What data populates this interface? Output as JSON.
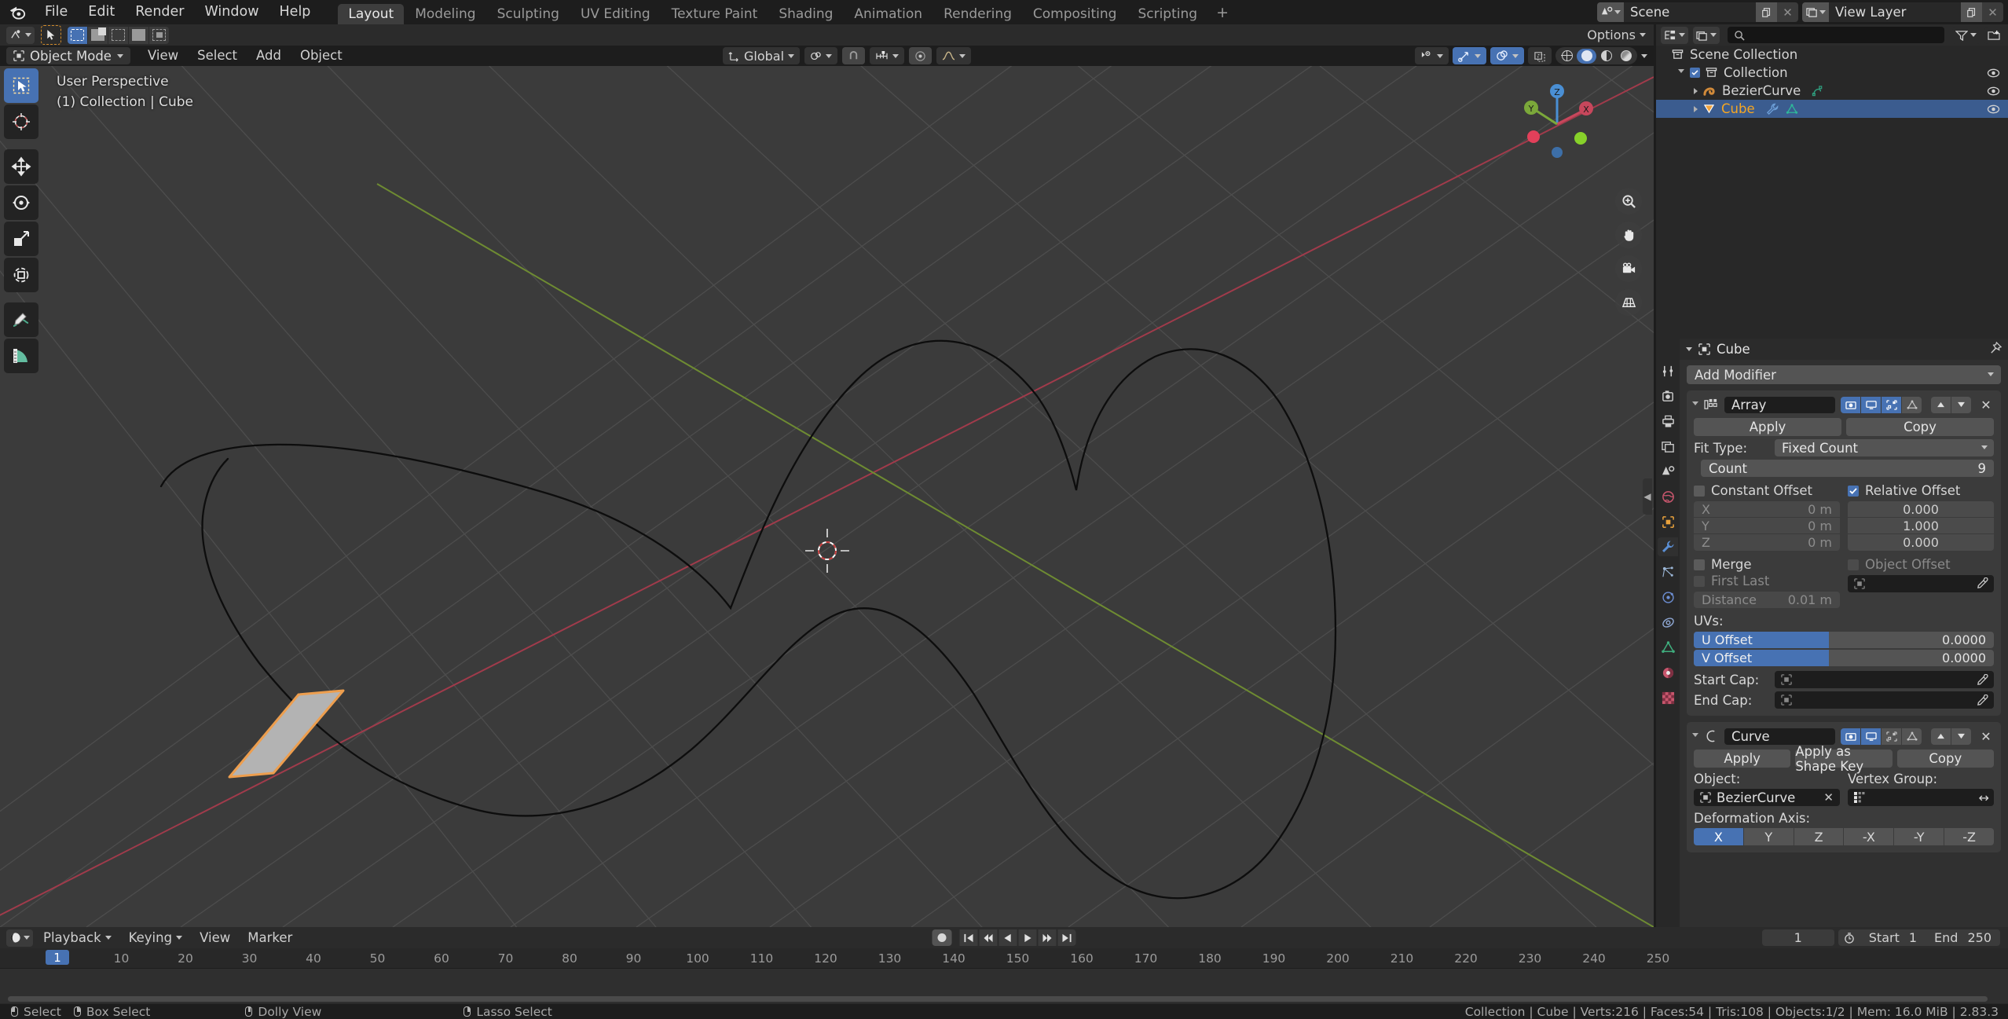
{
  "topbar": {
    "logo_icon": "blender-logo-icon",
    "menus": [
      "File",
      "Edit",
      "Render",
      "Window",
      "Help"
    ],
    "workspace_tabs": [
      {
        "label": "Layout",
        "active": true
      },
      {
        "label": "Modeling",
        "active": false
      },
      {
        "label": "Sculpting",
        "active": false
      },
      {
        "label": "UV Editing",
        "active": false
      },
      {
        "label": "Texture Paint",
        "active": false
      },
      {
        "label": "Shading",
        "active": false
      },
      {
        "label": "Animation",
        "active": false
      },
      {
        "label": "Rendering",
        "active": false
      },
      {
        "label": "Compositing",
        "active": false
      },
      {
        "label": "Scripting",
        "active": false
      }
    ],
    "add_workspace_label": "+",
    "scene_name": "Scene",
    "view_layer_name": "View Layer"
  },
  "tool_settings": {
    "active_tool_icon": "cursor-select-icon",
    "select_modes": [
      "set",
      "extend",
      "subtract",
      "invert",
      "intersect"
    ],
    "options_label": "Options"
  },
  "viewport_header": {
    "mode": "Object Mode",
    "menus": [
      "View",
      "Select",
      "Add",
      "Object"
    ],
    "transform_orientation": "Global",
    "pivot_icon": "pivot-icon",
    "snap_icon": "magnet-icon",
    "snap_to_icon": "snap-increment-icon",
    "proportional_icon": "proportional-editing-icon",
    "falloff_icon": "falloff-curve-icon",
    "visibility_icon": "object-type-visibility-icon",
    "gizmo_icon": "gizmo-icon",
    "overlays_icon": "overlays-icon",
    "xray_icon": "xray-icon",
    "shading_modes": [
      "wireframe",
      "solid",
      "material-preview",
      "rendered"
    ],
    "shading_active": "solid"
  },
  "viewport": {
    "perspective_label": "User Perspective",
    "scene_label": "(1) Collection | Cube",
    "tools": [
      "tweak-select-tool",
      "cursor-tool",
      "move-tool",
      "rotate-tool",
      "scale-tool",
      "transform-tool",
      "annotate-tool",
      "measure-tool"
    ],
    "gizmo_axes": [
      "X",
      "Y",
      "Z"
    ],
    "nav_buttons": [
      "zoom-icon",
      "pan-hand-icon",
      "camera-view-icon",
      "toggle-ortho-icon"
    ],
    "cube_color": "#b3b3b3",
    "cube_outline": "#ed9e4e",
    "curve_color": "#0d0d0d",
    "x_axis_color": "#a03b4b",
    "y_axis_color": "#6e8b32"
  },
  "outliner": {
    "display_mode_icon": "outliner-display-mode-icon",
    "filter_icon": "filter-funnel-icon",
    "new_collection_icon": "new-collection-icon",
    "search_placeholder": "",
    "rows": [
      {
        "label": "Scene Collection",
        "icon": "collection-icon",
        "depth": 0,
        "selected": false,
        "has_eye": false,
        "has_check": false,
        "expand": "none"
      },
      {
        "label": "Collection",
        "icon": "collection-icon",
        "depth": 1,
        "selected": false,
        "has_eye": true,
        "has_check": true,
        "expand": "down"
      },
      {
        "label": "BezierCurve",
        "icon": "curve-data-icon",
        "depth": 2,
        "selected": false,
        "has_eye": true,
        "has_check": false,
        "expand": "right",
        "extra_icon": "curve-object-icon"
      },
      {
        "label": "Cube",
        "icon": "mesh-data-icon",
        "depth": 2,
        "selected": true,
        "has_eye": true,
        "has_check": false,
        "expand": "right",
        "extra_icon": "modifier-wrench-icon",
        "extra_icon2": "mesh-triangle-icon"
      }
    ]
  },
  "properties": {
    "breadcrumb_object": "Cube",
    "breadcrumb_icon": "object-data-icon",
    "pin_icon": "pin-icon",
    "tabs": [
      "tool-icon",
      "render-icon",
      "output-icon",
      "view-layer-icon",
      "scene-icon",
      "world-icon",
      "object-icon",
      "modifier-wrench-icon",
      "particles-icon",
      "physics-icon",
      "constraints-icon",
      "object-data-icon",
      "material-icon",
      "texture-icon"
    ],
    "active_tab": "modifier-wrench-icon",
    "add_modifier_label": "Add Modifier",
    "modifiers": [
      {
        "name": "Array",
        "icon": "array-modifier-icon",
        "toggles": [
          {
            "icon": "render-camera-icon",
            "on": true
          },
          {
            "icon": "display-monitor-icon",
            "on": true
          },
          {
            "icon": "edit-mode-icon",
            "on": true
          },
          {
            "icon": "on-cage-icon",
            "on": false
          }
        ],
        "buttons": [
          "Apply",
          "Copy"
        ],
        "fit_type_label": "Fit Type:",
        "fit_type_value": "Fixed Count",
        "count_label": "Count",
        "count_value": "9",
        "constant_offset_label": "Constant Offset",
        "constant_offset_on": false,
        "constant_offset_fields": [
          {
            "label": "X",
            "value": "0 m"
          },
          {
            "label": "Y",
            "value": "0 m"
          },
          {
            "label": "Z",
            "value": "0 m"
          }
        ],
        "relative_offset_label": "Relative Offset",
        "relative_offset_on": true,
        "relative_offset_fields": [
          "0.000",
          "1.000",
          "0.000"
        ],
        "merge_label": "Merge",
        "merge_on": false,
        "first_last_label": "First Last",
        "first_last_on": false,
        "distance_label": "Distance",
        "distance_value": "0.01 m",
        "object_offset_label": "Object Offset",
        "object_offset_on": false,
        "object_offset_value": "",
        "uvs_label": "UVs:",
        "u_offset_label": "U Offset",
        "u_offset_value": "0.0000",
        "v_offset_label": "V Offset",
        "v_offset_value": "0.0000",
        "start_cap_label": "Start Cap:",
        "start_cap_value": "",
        "end_cap_label": "End Cap:",
        "end_cap_value": ""
      },
      {
        "name": "Curve",
        "icon": "curve-modifier-icon",
        "toggles": [
          {
            "icon": "render-camera-icon",
            "on": true
          },
          {
            "icon": "display-monitor-icon",
            "on": true
          },
          {
            "icon": "edit-mode-icon",
            "on": false
          },
          {
            "icon": "on-cage-icon",
            "on": false
          }
        ],
        "buttons": [
          "Apply",
          "Apply as Shape Key",
          "Copy"
        ],
        "object_label": "Object:",
        "object_value": "BezierCurve",
        "vertex_group_label": "Vertex Group:",
        "vertex_group_value": "",
        "deformation_axis_label": "Deformation Axis:",
        "deformation_axes": [
          "X",
          "Y",
          "Z",
          "-X",
          "-Y",
          "-Z"
        ],
        "deformation_active": "X"
      }
    ]
  },
  "timeline": {
    "editor_icon": "timeline-editor-icon",
    "menus": [
      "Playback",
      "Keying",
      "View",
      "Marker"
    ],
    "playback_buttons": [
      "jump-start-icon",
      "prev-keyframe-icon",
      "play-reverse-icon",
      "play-icon",
      "next-keyframe-icon",
      "jump-end-icon"
    ],
    "record_icon": "auto-keying-icon",
    "current_frame": "1",
    "frame_clock_icon": "clock-icon",
    "start_label": "Start",
    "start_value": "1",
    "end_label": "End",
    "end_value": "250",
    "ticks": [
      "10",
      "20",
      "30",
      "40",
      "50",
      "60",
      "70",
      "80",
      "90",
      "100",
      "110",
      "120",
      "130",
      "140",
      "150",
      "160",
      "170",
      "180",
      "190",
      "200",
      "210",
      "220",
      "230",
      "240",
      "250"
    ],
    "playhead_label": "1"
  },
  "status_bar": {
    "hints": [
      {
        "mouse": "l",
        "label": "Select"
      },
      {
        "mouse": "r",
        "label": "Box Select"
      },
      {
        "mouse": "m",
        "label": "Dolly View"
      },
      {
        "mouse": "r",
        "label": "Lasso Select"
      }
    ],
    "stats": "Collection | Cube | Verts:216 | Faces:54 | Tris:108 | Objects:1/2 | Mem: 16.0 MiB | 2.83.3"
  }
}
